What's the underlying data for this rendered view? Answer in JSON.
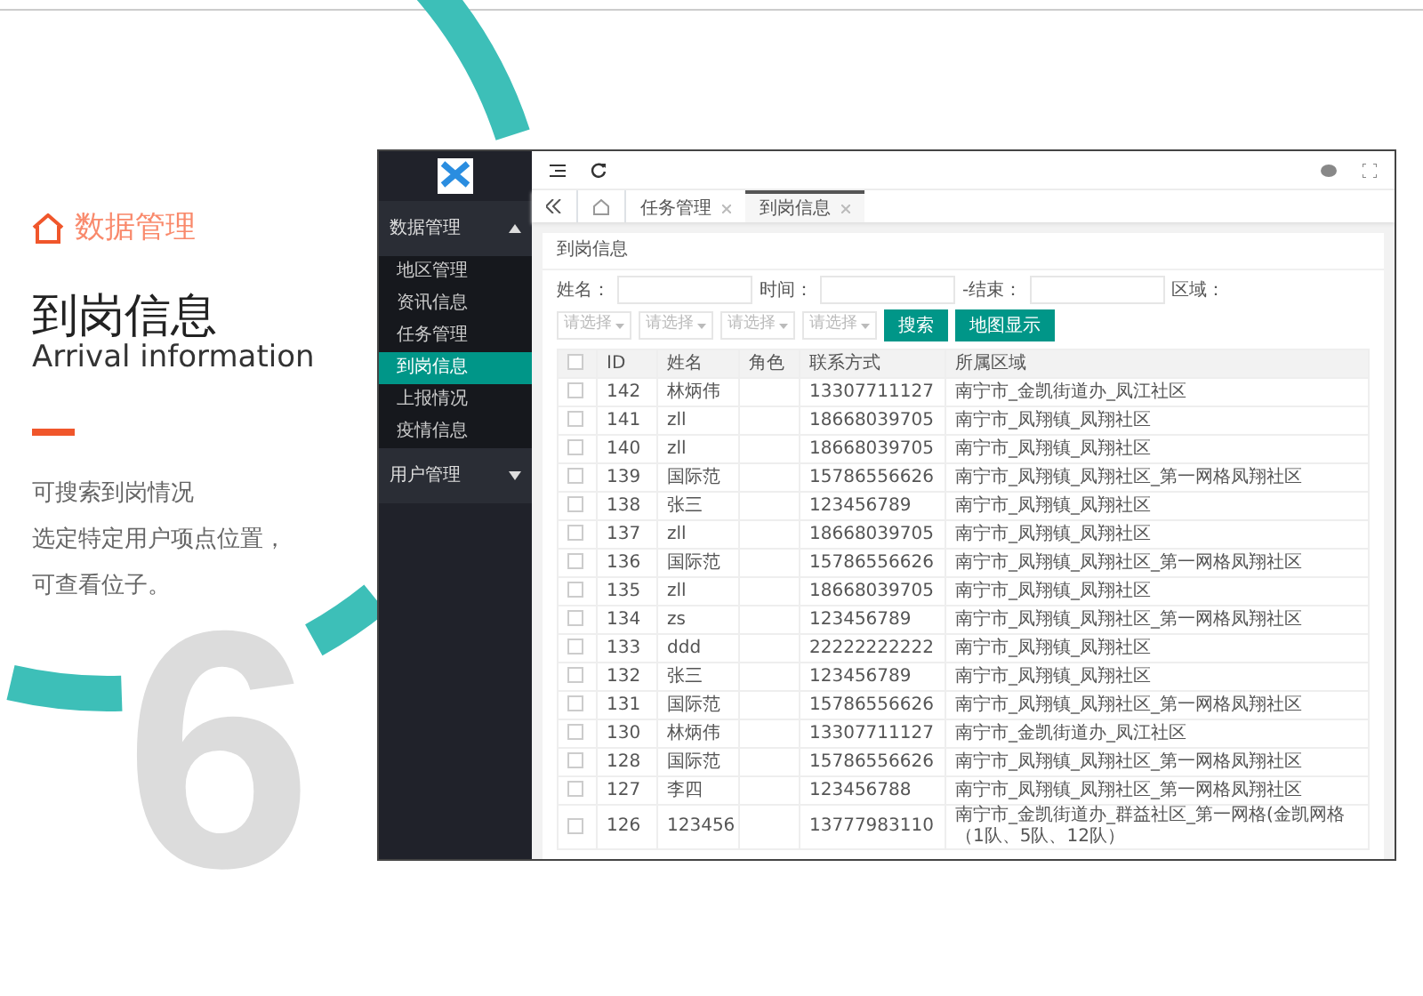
{
  "intro": {
    "section": "数据管理",
    "title": "到岗信息",
    "subtitle": "Arrival information",
    "description_lines": [
      "可搜索到岗情况",
      "选定特定用户项点位置，",
      "可查看位子。"
    ],
    "big_number": "6"
  },
  "sidebar": {
    "groups": [
      {
        "label": "数据管理",
        "expanded": true,
        "items": [
          {
            "label": "地区管理",
            "selected": false
          },
          {
            "label": "资讯信息",
            "selected": false
          },
          {
            "label": "任务管理",
            "selected": false
          },
          {
            "label": "到岗信息",
            "selected": true
          },
          {
            "label": "上报情况",
            "selected": false
          },
          {
            "label": "疫情信息",
            "selected": false
          }
        ]
      },
      {
        "label": "用户管理",
        "expanded": false
      }
    ]
  },
  "tabs": [
    {
      "label": "任务管理",
      "selected": false
    },
    {
      "label": "到岗信息",
      "selected": true
    }
  ],
  "panel": {
    "title": "到岗信息",
    "filters": [
      {
        "label": "姓名："
      },
      {
        "label": "时间："
      },
      {
        "label": "-结束："
      },
      {
        "label": "区域："
      }
    ],
    "selects": [
      {
        "placeholder": "请选择"
      },
      {
        "placeholder": "请选择"
      },
      {
        "placeholder": "请选择"
      },
      {
        "placeholder": "请选择"
      }
    ],
    "buttons": [
      "搜索",
      "地图显示"
    ]
  },
  "table": {
    "header_checked": false,
    "columns": [
      "ID",
      "姓名",
      "角色",
      "联系方式",
      "所属区域"
    ],
    "rows": [
      {
        "checked": false,
        "cells": [
          "142",
          "林炳伟",
          "",
          "13307711127",
          "南宁市_金凯街道办_凤江社区"
        ]
      },
      {
        "checked": false,
        "cells": [
          "141",
          "zll",
          "",
          "18668039705",
          "南宁市_凤翔镇_凤翔社区"
        ]
      },
      {
        "checked": false,
        "cells": [
          "140",
          "zll",
          "",
          "18668039705",
          "南宁市_凤翔镇_凤翔社区"
        ]
      },
      {
        "checked": false,
        "cells": [
          "139",
          "国际范",
          "",
          "15786556626",
          "南宁市_凤翔镇_凤翔社区_第一网格凤翔社区"
        ]
      },
      {
        "checked": false,
        "cells": [
          "138",
          "张三",
          "",
          "123456789",
          "南宁市_凤翔镇_凤翔社区"
        ]
      },
      {
        "checked": false,
        "cells": [
          "137",
          "zll",
          "",
          "18668039705",
          "南宁市_凤翔镇_凤翔社区"
        ]
      },
      {
        "checked": false,
        "cells": [
          "136",
          "国际范",
          "",
          "15786556626",
          "南宁市_凤翔镇_凤翔社区_第一网格凤翔社区"
        ]
      },
      {
        "checked": false,
        "cells": [
          "135",
          "zll",
          "",
          "18668039705",
          "南宁市_凤翔镇_凤翔社区"
        ]
      },
      {
        "checked": false,
        "cells": [
          "134",
          "zs",
          "",
          "123456789",
          "南宁市_凤翔镇_凤翔社区_第一网格凤翔社区"
        ]
      },
      {
        "checked": false,
        "cells": [
          "133",
          "ddd",
          "",
          "22222222222",
          "南宁市_凤翔镇_凤翔社区"
        ]
      },
      {
        "checked": false,
        "cells": [
          "132",
          "张三",
          "",
          "123456789",
          "南宁市_凤翔镇_凤翔社区"
        ]
      },
      {
        "checked": false,
        "cells": [
          "131",
          "国际范",
          "",
          "15786556626",
          "南宁市_凤翔镇_凤翔社区_第一网格凤翔社区"
        ]
      },
      {
        "checked": false,
        "cells": [
          "130",
          "林炳伟",
          "",
          "13307711127",
          "南宁市_金凯街道办_凤江社区"
        ]
      },
      {
        "checked": false,
        "cells": [
          "128",
          "国际范",
          "",
          "15786556626",
          "南宁市_凤翔镇_凤翔社区_第一网格凤翔社区"
        ]
      },
      {
        "checked": false,
        "cells": [
          "127",
          "李四",
          "",
          "123456788",
          "南宁市_凤翔镇_凤翔社区_第一网格凤翔社区"
        ]
      },
      {
        "checked": false,
        "cells": [
          "126",
          "123456",
          "",
          "13777983110",
          "南宁市_金凯街道办_群益社区_第一网格(金凯网格（1队、5队、12队）"
        ]
      }
    ]
  }
}
